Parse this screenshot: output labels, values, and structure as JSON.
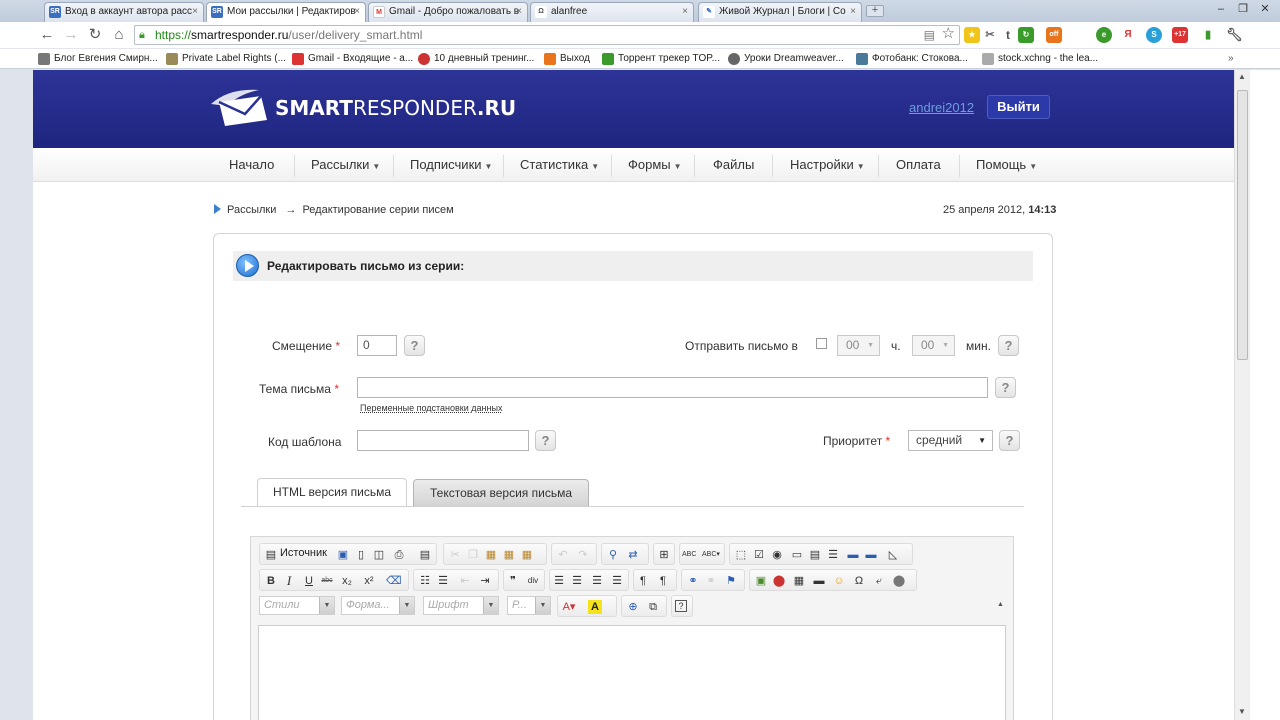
{
  "browser": {
    "tabs": [
      {
        "label": "Вход в аккаунт автора расс",
        "fav": "SR",
        "color": "#3a6fc0"
      },
      {
        "label": "Мои рассылки | Редактиров",
        "fav": "SR",
        "color": "#3a6fc0"
      },
      {
        "label": "Gmail - Добро пожаловать в",
        "fav": "M",
        "color": "#d33"
      },
      {
        "label": "alanfree",
        "fav": "Ω",
        "color": "#666"
      },
      {
        "label": "Живой Журнал | Блоги | Со",
        "fav": "✎",
        "color": "#3a6fc0"
      }
    ],
    "url": {
      "https": "https://",
      "host": "smartresponder.ru",
      "path": "/user/delivery_smart.html"
    },
    "bookmarks": [
      "Блог Евгения Смирн...",
      "Private Label Rights (...",
      "Gmail - Входящие - a...",
      "10 дневный тренинг...",
      "Выход",
      "Торрент трекер TOP...",
      "Уроки Dreamweaver...",
      "Фотобанк: Стокова...",
      "stock.xchng - the lea..."
    ]
  },
  "site": {
    "logo_bold": "SMART",
    "logo_thin": "RESPONDER",
    "logo_tld": ".RU",
    "username": "andrei2012",
    "logout": "Выйти"
  },
  "nav": [
    {
      "label": "Начало",
      "caret": false
    },
    {
      "label": "Рассылки",
      "caret": true
    },
    {
      "label": "Подписчики",
      "caret": true
    },
    {
      "label": "Статистика",
      "caret": true
    },
    {
      "label": "Формы",
      "caret": true
    },
    {
      "label": "Файлы",
      "caret": false
    },
    {
      "label": "Настройки",
      "caret": true
    },
    {
      "label": "Оплата",
      "caret": false
    },
    {
      "label": "Помощь",
      "caret": true
    }
  ],
  "breadcrumb": {
    "root": "Рассылки",
    "arrow": "→",
    "current": "Редактирование серии писем"
  },
  "datetime": {
    "date": "25 апреля 2012,",
    "time": "14:13"
  },
  "form": {
    "title": "Редактировать письмо из серии:",
    "offset_label": "Смещение",
    "offset_value": "0",
    "send_at_label": "Отправить письмо в",
    "hours_value": "00",
    "hours_unit": "ч.",
    "minutes_value": "00",
    "minutes_unit": "мин.",
    "subject_label": "Тема письма",
    "subject_value": "",
    "vars_hint": "Переменные подстановки данных",
    "template_label": "Код шаблона",
    "template_value": "",
    "priority_label": "Приоритет",
    "priority_value": "средний",
    "required_mark": "*",
    "help": "?"
  },
  "tabs": {
    "html": "HTML версия письма",
    "text": "Текстовая версия письма"
  },
  "editor": {
    "source": "Источник",
    "combos": [
      "Стили",
      "Форма...",
      "Шрифт",
      "Р..."
    ]
  }
}
